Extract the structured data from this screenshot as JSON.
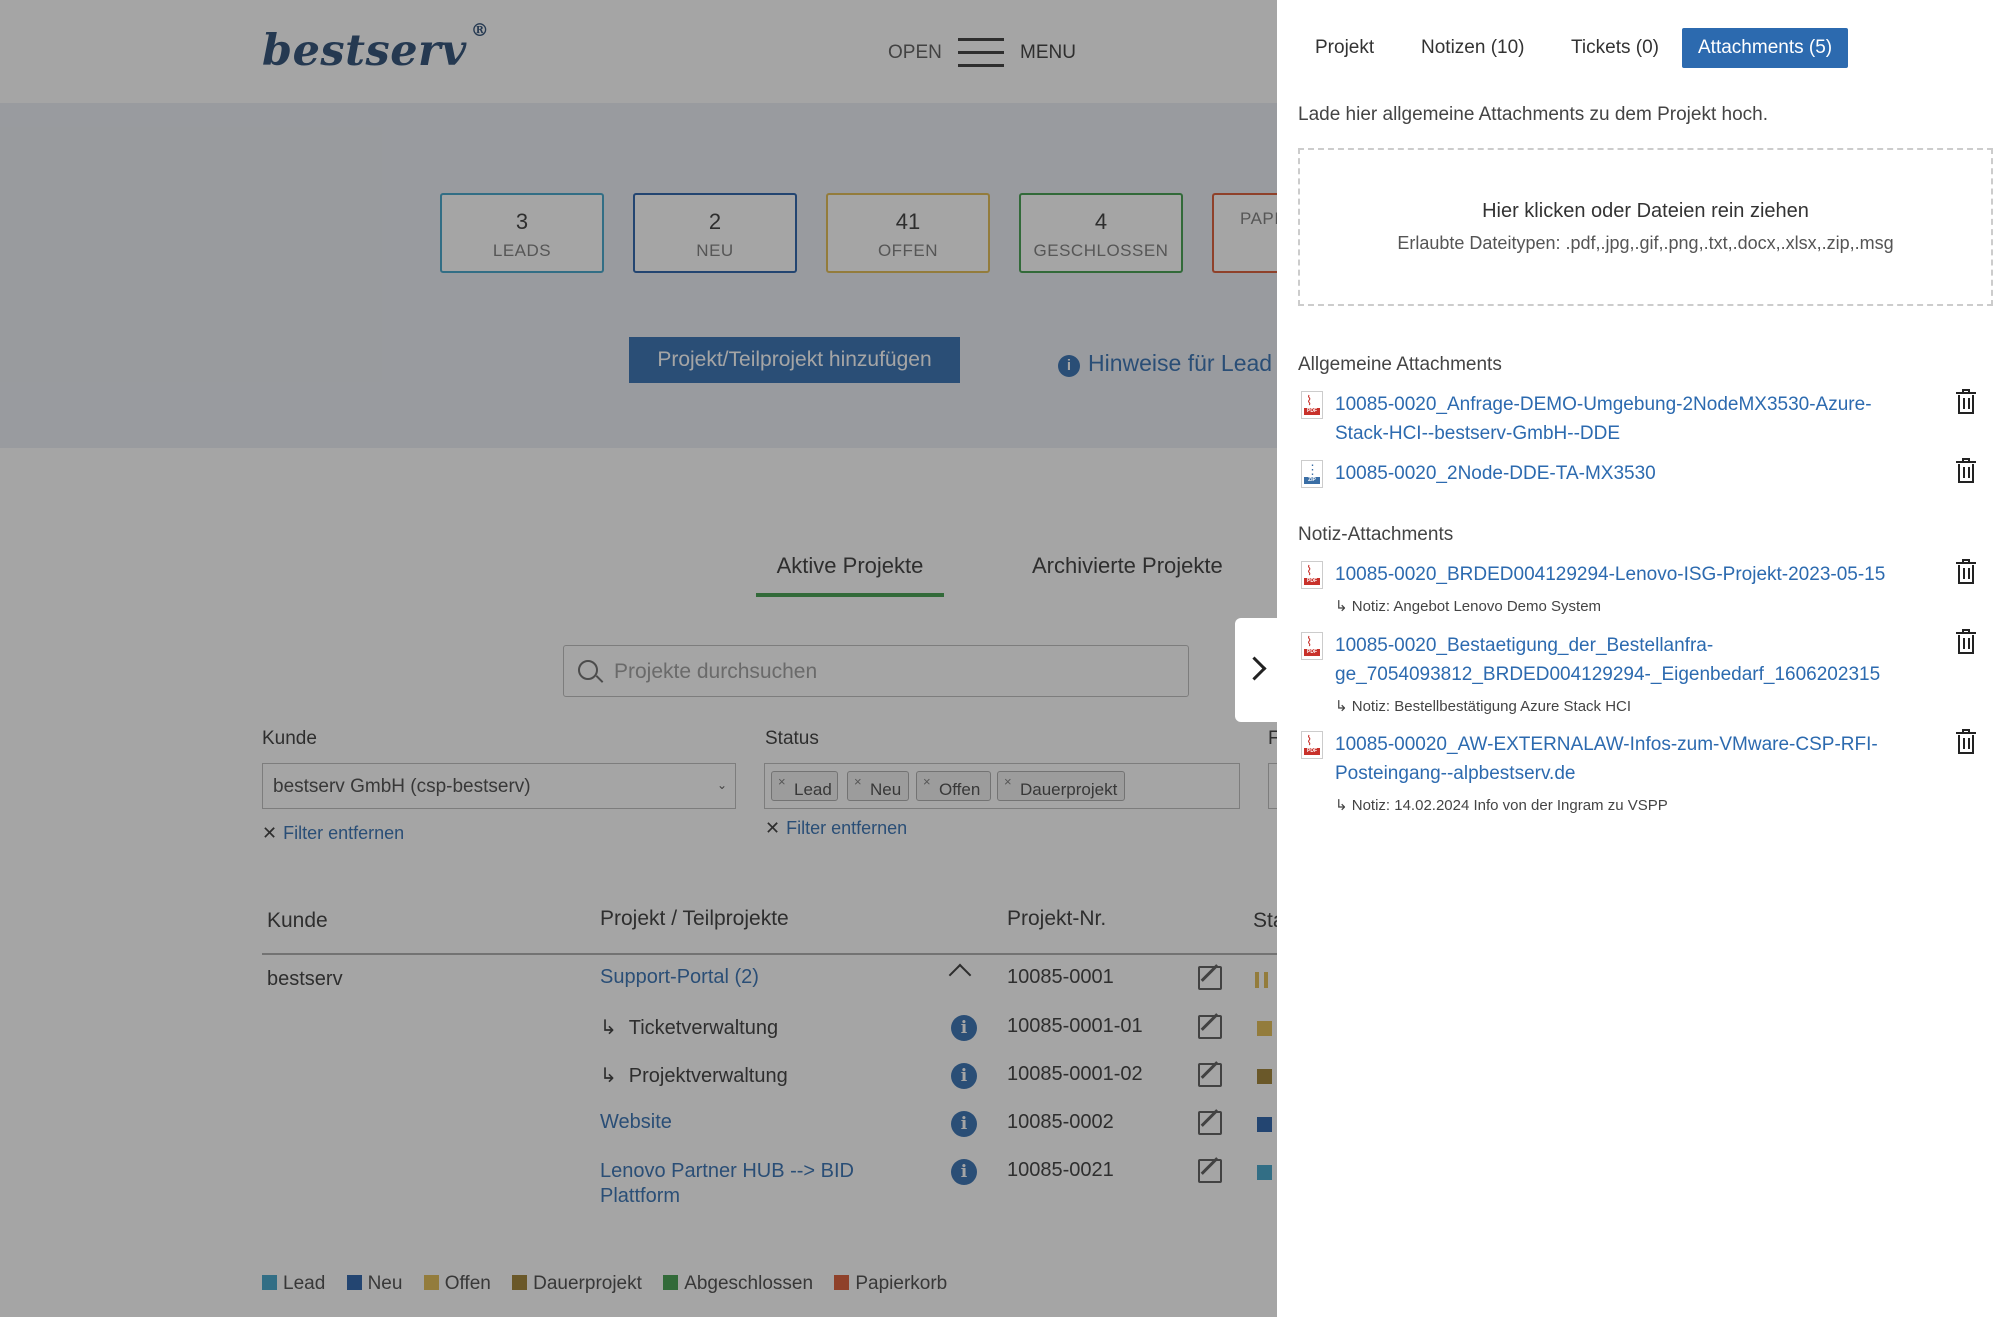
{
  "header": {
    "logo": "bestserv",
    "logo_mark": "®",
    "open_label": "OPEN",
    "menu_label": "MENU"
  },
  "stats": [
    {
      "value": "3",
      "label": "LEADS",
      "color": "#3aa0c8"
    },
    {
      "value": "2",
      "label": "NEU",
      "color": "#1f5aa6"
    },
    {
      "value": "41",
      "label": "OFFEN",
      "color": "#e0b84a"
    },
    {
      "value": "4",
      "label": "GESCHLOSSEN",
      "color": "#3a9a46"
    },
    {
      "value": "",
      "label": "PAPI",
      "color": "#d9542c"
    }
  ],
  "actions": {
    "add_project": "Projekt/Teilprojekt hinzufügen",
    "hint": "Hinweise für Lead"
  },
  "project_tabs": {
    "active": "Aktive Projekte",
    "archived": "Archivierte Projekte"
  },
  "search": {
    "placeholder": "Projekte durchsuchen"
  },
  "filters": {
    "kunde_label": "Kunde",
    "kunde_value": "bestserv GmbH (csp-bestserv)",
    "status_label": "Status",
    "status_tags": [
      "Lead",
      "Neu",
      "Offen",
      "Dauerprojekt"
    ],
    "remove_filter": "Filter entfernen",
    "truncated_label": "F"
  },
  "table": {
    "headers": [
      "Kunde",
      "Projekt / Teilprojekte",
      "Projekt-Nr.",
      "Sta"
    ],
    "rows": [
      {
        "kunde": "bestserv",
        "projekt": "Support-Portal (2)",
        "nr": "10085-0001",
        "status_color": "#e0b84a",
        "sub": false
      },
      {
        "kunde": "",
        "projekt": "Ticketverwaltung",
        "nr": "10085-0001-01",
        "status_color": "#e0b84a",
        "sub": true
      },
      {
        "kunde": "",
        "projekt": "Projektverwaltung",
        "nr": "10085-0001-02",
        "status_color": "#9a7a2a",
        "sub": true
      },
      {
        "kunde": "",
        "projekt": "Website",
        "nr": "10085-0002",
        "status_color": "#1f5aa6",
        "sub": false
      },
      {
        "kunde": "",
        "projekt": "Lenovo Partner HUB --> BID Plattform",
        "nr": "10085-0021",
        "status_color": "#3aa0c8",
        "sub": false
      }
    ]
  },
  "legend": [
    {
      "label": "Lead",
      "color": "#3aa0c8"
    },
    {
      "label": "Neu",
      "color": "#1f5aa6"
    },
    {
      "label": "Offen",
      "color": "#e0b84a"
    },
    {
      "label": "Dauerprojekt",
      "color": "#9a7a2a"
    },
    {
      "label": "Abgeschlossen",
      "color": "#3a9a46"
    },
    {
      "label": "Papierkorb",
      "color": "#d9542c"
    }
  ],
  "panel": {
    "tabs": [
      "Projekt",
      "Notizen (10)",
      "Tickets (0)",
      "Attachments (5)"
    ],
    "active_tab": "Attachments (5)",
    "intro": "Lade hier allgemeine Attachments zu dem Projekt hoch.",
    "dropzone_title": "Hier klicken oder Dateien rein ziehen",
    "dropzone_types": "Erlaubte Dateitypen: .pdf,.jpg,.gif,.png,.txt,.docx,.xlsx,.zip,.msg",
    "general_title": "Allgemeine Attachments",
    "general": [
      {
        "name": "10085-0020_Anfrage-DEMO-Umgebung-2NodeMX3530-Azure-Stack-HCI--bestserv-GmbH--DDE",
        "type": "pdf"
      },
      {
        "name": "10085-0020_2Node-DDE-TA-MX3530",
        "type": "zip"
      }
    ],
    "notes_title": "Notiz-Attachments",
    "notes": [
      {
        "name": "10085-0020_BRDED004129294-Lenovo-ISG-Projekt-2023-05-15",
        "note": "↳ Notiz: Angebot Lenovo Demo System",
        "type": "pdf"
      },
      {
        "name": "10085-0020_Bestaetigung_der_Bestellanfra-ge_7054093812_BRDED004129294-_Eigenbedarf_1606202315",
        "note": "↳ Notiz: Bestellbestätigung Azure Stack HCI",
        "type": "pdf"
      },
      {
        "name": "10085-00020_AW-EXTERNALAW-Infos-zum-VMware-CSP-RFI-Posteingang--alpbestserv.de",
        "note": "↳ Notiz: 14.02.2024 Info von der Ingram zu VSPP",
        "type": "pdf"
      }
    ]
  }
}
